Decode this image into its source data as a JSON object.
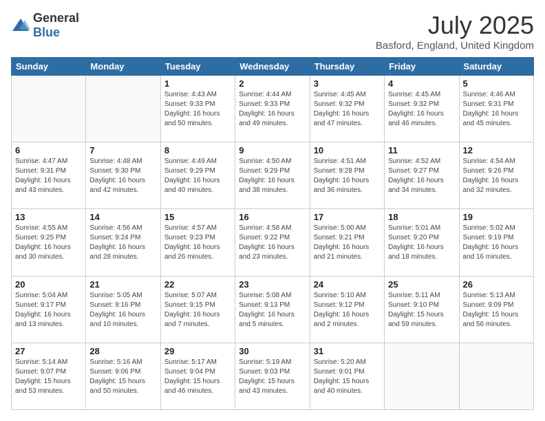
{
  "header": {
    "logo_general": "General",
    "logo_blue": "Blue",
    "month_title": "July 2025",
    "location": "Basford, England, United Kingdom"
  },
  "days_of_week": [
    "Sunday",
    "Monday",
    "Tuesday",
    "Wednesday",
    "Thursday",
    "Friday",
    "Saturday"
  ],
  "weeks": [
    [
      {
        "day": "",
        "info": ""
      },
      {
        "day": "",
        "info": ""
      },
      {
        "day": "1",
        "info": "Sunrise: 4:43 AM\nSunset: 9:33 PM\nDaylight: 16 hours and 50 minutes."
      },
      {
        "day": "2",
        "info": "Sunrise: 4:44 AM\nSunset: 9:33 PM\nDaylight: 16 hours and 49 minutes."
      },
      {
        "day": "3",
        "info": "Sunrise: 4:45 AM\nSunset: 9:32 PM\nDaylight: 16 hours and 47 minutes."
      },
      {
        "day": "4",
        "info": "Sunrise: 4:45 AM\nSunset: 9:32 PM\nDaylight: 16 hours and 46 minutes."
      },
      {
        "day": "5",
        "info": "Sunrise: 4:46 AM\nSunset: 9:31 PM\nDaylight: 16 hours and 45 minutes."
      }
    ],
    [
      {
        "day": "6",
        "info": "Sunrise: 4:47 AM\nSunset: 9:31 PM\nDaylight: 16 hours and 43 minutes."
      },
      {
        "day": "7",
        "info": "Sunrise: 4:48 AM\nSunset: 9:30 PM\nDaylight: 16 hours and 42 minutes."
      },
      {
        "day": "8",
        "info": "Sunrise: 4:49 AM\nSunset: 9:29 PM\nDaylight: 16 hours and 40 minutes."
      },
      {
        "day": "9",
        "info": "Sunrise: 4:50 AM\nSunset: 9:29 PM\nDaylight: 16 hours and 38 minutes."
      },
      {
        "day": "10",
        "info": "Sunrise: 4:51 AM\nSunset: 9:28 PM\nDaylight: 16 hours and 36 minutes."
      },
      {
        "day": "11",
        "info": "Sunrise: 4:52 AM\nSunset: 9:27 PM\nDaylight: 16 hours and 34 minutes."
      },
      {
        "day": "12",
        "info": "Sunrise: 4:54 AM\nSunset: 9:26 PM\nDaylight: 16 hours and 32 minutes."
      }
    ],
    [
      {
        "day": "13",
        "info": "Sunrise: 4:55 AM\nSunset: 9:25 PM\nDaylight: 16 hours and 30 minutes."
      },
      {
        "day": "14",
        "info": "Sunrise: 4:56 AM\nSunset: 9:24 PM\nDaylight: 16 hours and 28 minutes."
      },
      {
        "day": "15",
        "info": "Sunrise: 4:57 AM\nSunset: 9:23 PM\nDaylight: 16 hours and 26 minutes."
      },
      {
        "day": "16",
        "info": "Sunrise: 4:58 AM\nSunset: 9:22 PM\nDaylight: 16 hours and 23 minutes."
      },
      {
        "day": "17",
        "info": "Sunrise: 5:00 AM\nSunset: 9:21 PM\nDaylight: 16 hours and 21 minutes."
      },
      {
        "day": "18",
        "info": "Sunrise: 5:01 AM\nSunset: 9:20 PM\nDaylight: 16 hours and 18 minutes."
      },
      {
        "day": "19",
        "info": "Sunrise: 5:02 AM\nSunset: 9:19 PM\nDaylight: 16 hours and 16 minutes."
      }
    ],
    [
      {
        "day": "20",
        "info": "Sunrise: 5:04 AM\nSunset: 9:17 PM\nDaylight: 16 hours and 13 minutes."
      },
      {
        "day": "21",
        "info": "Sunrise: 5:05 AM\nSunset: 9:16 PM\nDaylight: 16 hours and 10 minutes."
      },
      {
        "day": "22",
        "info": "Sunrise: 5:07 AM\nSunset: 9:15 PM\nDaylight: 16 hours and 7 minutes."
      },
      {
        "day": "23",
        "info": "Sunrise: 5:08 AM\nSunset: 9:13 PM\nDaylight: 16 hours and 5 minutes."
      },
      {
        "day": "24",
        "info": "Sunrise: 5:10 AM\nSunset: 9:12 PM\nDaylight: 16 hours and 2 minutes."
      },
      {
        "day": "25",
        "info": "Sunrise: 5:11 AM\nSunset: 9:10 PM\nDaylight: 15 hours and 59 minutes."
      },
      {
        "day": "26",
        "info": "Sunrise: 5:13 AM\nSunset: 9:09 PM\nDaylight: 15 hours and 56 minutes."
      }
    ],
    [
      {
        "day": "27",
        "info": "Sunrise: 5:14 AM\nSunset: 9:07 PM\nDaylight: 15 hours and 53 minutes."
      },
      {
        "day": "28",
        "info": "Sunrise: 5:16 AM\nSunset: 9:06 PM\nDaylight: 15 hours and 50 minutes."
      },
      {
        "day": "29",
        "info": "Sunrise: 5:17 AM\nSunset: 9:04 PM\nDaylight: 15 hours and 46 minutes."
      },
      {
        "day": "30",
        "info": "Sunrise: 5:19 AM\nSunset: 9:03 PM\nDaylight: 15 hours and 43 minutes."
      },
      {
        "day": "31",
        "info": "Sunrise: 5:20 AM\nSunset: 9:01 PM\nDaylight: 15 hours and 40 minutes."
      },
      {
        "day": "",
        "info": ""
      },
      {
        "day": "",
        "info": ""
      }
    ]
  ]
}
